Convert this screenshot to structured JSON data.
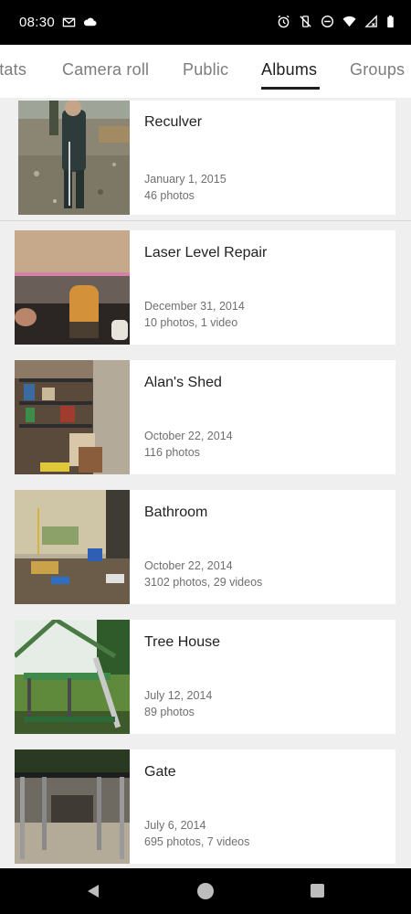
{
  "status_bar": {
    "time": "08:30",
    "left_icons": [
      "mail-icon",
      "cloud-icon"
    ],
    "right_icons": [
      "alarm-icon",
      "vibrate-off-icon",
      "do-not-disturb-icon",
      "wifi-icon",
      "signal-icon",
      "battery-icon"
    ]
  },
  "tabs": [
    {
      "label": "Stats",
      "active": false
    },
    {
      "label": "Camera roll",
      "active": false
    },
    {
      "label": "Public",
      "active": false
    },
    {
      "label": "Albums",
      "active": true
    },
    {
      "label": "Groups",
      "active": false
    }
  ],
  "albums": [
    {
      "title": "Reculver",
      "date": "January 1, 2015",
      "count": "46 photos"
    },
    {
      "title": "Laser Level Repair",
      "date": "December 31, 2014",
      "count": "10 photos, 1 video"
    },
    {
      "title": "Alan's Shed",
      "date": "October 22, 2014",
      "count": "116 photos"
    },
    {
      "title": "Bathroom",
      "date": "October 22, 2014",
      "count": "3102 photos, 29 videos"
    },
    {
      "title": "Tree House",
      "date": "July 12, 2014",
      "count": "89 photos"
    },
    {
      "title": "Gate",
      "date": "July 6, 2014",
      "count": "695 photos, 7 videos"
    }
  ],
  "nav_bar": {
    "back_icon": "back-triangle-icon",
    "home_icon": "home-circle-icon",
    "recents_icon": "recents-square-icon"
  }
}
